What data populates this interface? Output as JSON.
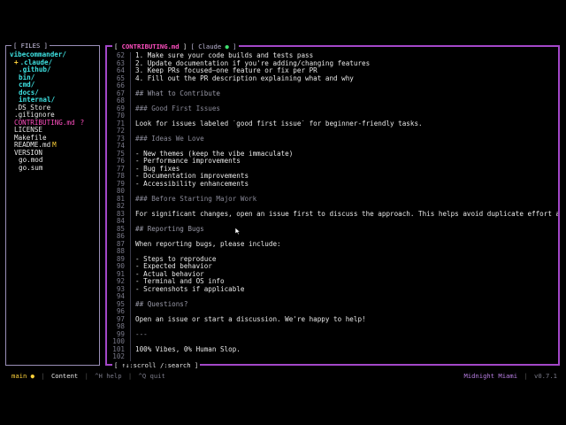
{
  "files_pane": {
    "title": "[ FILES ]",
    "items": [
      {
        "label": "vibecommander/",
        "kind": "dir",
        "indent": 0,
        "marker": ""
      },
      {
        "label": ".claude/",
        "kind": "dir",
        "indent": 1,
        "marker": "+"
      },
      {
        "label": ".github/",
        "kind": "dir",
        "indent": 2,
        "marker": ""
      },
      {
        "label": "bin/",
        "kind": "dir",
        "indent": 2,
        "marker": ""
      },
      {
        "label": "cmd/",
        "kind": "dir",
        "indent": 2,
        "marker": ""
      },
      {
        "label": "docs/",
        "kind": "dir",
        "indent": 2,
        "marker": ""
      },
      {
        "label": "internal/",
        "kind": "dir",
        "indent": 2,
        "marker": ""
      },
      {
        "label": ".DS_Store",
        "kind": "file",
        "indent": 1,
        "marker": ""
      },
      {
        "label": ".gitignore",
        "kind": "file",
        "indent": 1,
        "marker": ""
      },
      {
        "label": "CONTRIBUTING.md",
        "kind": "current",
        "indent": 1,
        "marker": "",
        "status": "?"
      },
      {
        "label": "LICENSE",
        "kind": "file",
        "indent": 1,
        "marker": ""
      },
      {
        "label": "Makefile",
        "kind": "file",
        "indent": 1,
        "marker": ""
      },
      {
        "label": "README.md",
        "kind": "file",
        "indent": 1,
        "marker": "",
        "status": "M"
      },
      {
        "label": "VERSION",
        "kind": "file",
        "indent": 1,
        "marker": ""
      },
      {
        "label": "go.mod",
        "kind": "file",
        "indent": 2,
        "marker": ""
      },
      {
        "label": "go.sum",
        "kind": "file",
        "indent": 2,
        "marker": ""
      }
    ]
  },
  "editor": {
    "active_tab": "CONTRIBUTING.md",
    "inactive_tab": "Claude",
    "bottom_hint_key": "↑↓:scroll",
    "bottom_hint_search": "/:search",
    "lines": [
      {
        "n": "62",
        "text": "1. Make sure your code builds and tests pass",
        "style": "normal"
      },
      {
        "n": "63",
        "text": "2. Update documentation if you're adding/changing features",
        "style": "normal"
      },
      {
        "n": "64",
        "text": "3. Keep PRs focused—one feature or fix per PR",
        "style": "normal"
      },
      {
        "n": "65",
        "text": "4. Fill out the PR description explaining what and why",
        "style": "normal"
      },
      {
        "n": "66",
        "text": "",
        "style": "normal"
      },
      {
        "n": "67",
        "text": "## What to Contribute",
        "style": "heading"
      },
      {
        "n": "68",
        "text": "",
        "style": "normal"
      },
      {
        "n": "69",
        "text": "### Good First Issues",
        "style": "subheading"
      },
      {
        "n": "70",
        "text": "",
        "style": "normal"
      },
      {
        "n": "71",
        "text": "Look for issues labeled `good first issue` for beginner-friendly tasks.",
        "style": "normal"
      },
      {
        "n": "72",
        "text": "",
        "style": "normal"
      },
      {
        "n": "73",
        "text": "### Ideas We Love",
        "style": "subheading"
      },
      {
        "n": "74",
        "text": "",
        "style": "normal"
      },
      {
        "n": "75",
        "text": "- New themes (keep the vibe immaculate)",
        "style": "normal"
      },
      {
        "n": "76",
        "text": "- Performance improvements",
        "style": "normal"
      },
      {
        "n": "77",
        "text": "- Bug fixes",
        "style": "normal"
      },
      {
        "n": "78",
        "text": "- Documentation improvements",
        "style": "normal"
      },
      {
        "n": "79",
        "text": "- Accessibility enhancements",
        "style": "normal"
      },
      {
        "n": "80",
        "text": "",
        "style": "normal"
      },
      {
        "n": "81",
        "text": "### Before Starting Major Work",
        "style": "subheading"
      },
      {
        "n": "82",
        "text": "",
        "style": "normal"
      },
      {
        "n": "83",
        "text": "For significant changes, open an issue first to discuss the approach. This helps avoid duplicate effort and ensur",
        "style": "normal"
      },
      {
        "n": "84",
        "text": "",
        "style": "normal"
      },
      {
        "n": "85",
        "text": "## Reporting Bugs",
        "style": "heading"
      },
      {
        "n": "86",
        "text": "",
        "style": "normal"
      },
      {
        "n": "87",
        "text": "When reporting bugs, please include:",
        "style": "normal"
      },
      {
        "n": "88",
        "text": "",
        "style": "normal"
      },
      {
        "n": "89",
        "text": "- Steps to reproduce",
        "style": "normal"
      },
      {
        "n": "90",
        "text": "- Expected behavior",
        "style": "normal"
      },
      {
        "n": "91",
        "text": "- Actual behavior",
        "style": "normal"
      },
      {
        "n": "92",
        "text": "- Terminal and OS info",
        "style": "normal"
      },
      {
        "n": "93",
        "text": "- Screenshots if applicable",
        "style": "normal"
      },
      {
        "n": "94",
        "text": "",
        "style": "normal"
      },
      {
        "n": "95",
        "text": "## Questions?",
        "style": "heading"
      },
      {
        "n": "96",
        "text": "",
        "style": "normal"
      },
      {
        "n": "97",
        "text": "Open an issue or start a discussion. We're happy to help!",
        "style": "normal"
      },
      {
        "n": "98",
        "text": "",
        "style": "normal"
      },
      {
        "n": "99",
        "text": "---",
        "style": "heading"
      },
      {
        "n": "100",
        "text": "",
        "style": "normal"
      },
      {
        "n": "101",
        "text": "100% Vibes, 0% Human Slop.",
        "style": "normal"
      },
      {
        "n": "102",
        "text": "",
        "style": "normal"
      }
    ]
  },
  "statusbar": {
    "branch": "main",
    "mode": "Content",
    "help": "^H help",
    "quit": "^Q quit",
    "theme": "Midnight Miami",
    "version": "v0.7.1"
  }
}
